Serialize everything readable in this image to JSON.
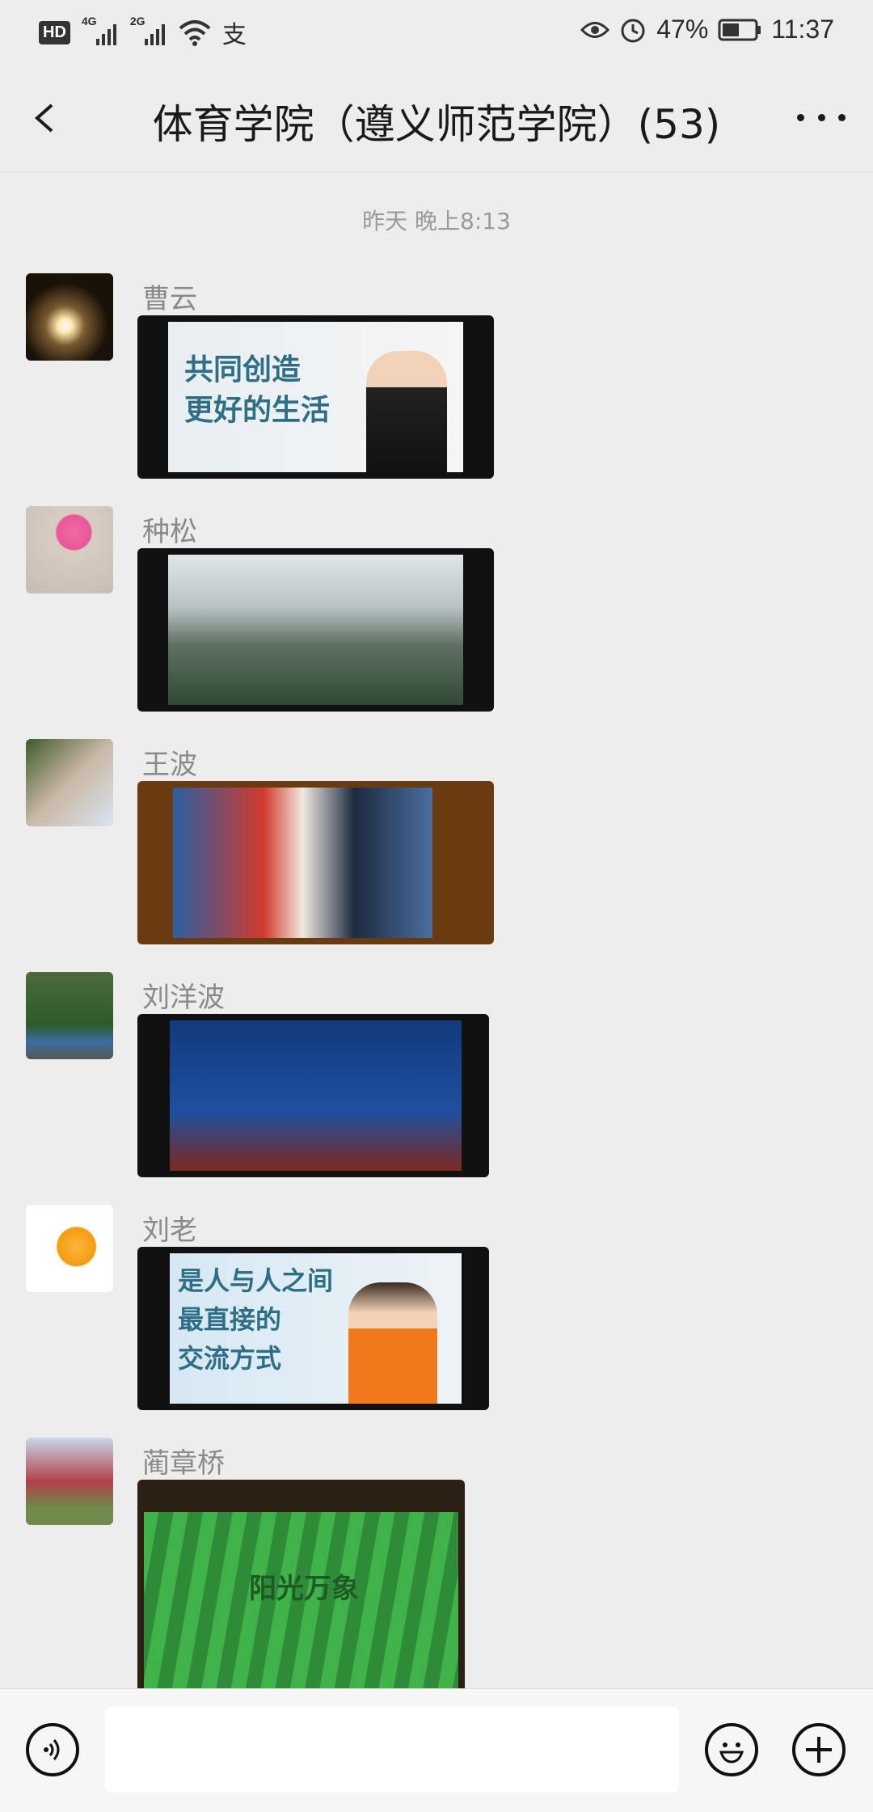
{
  "status": {
    "network": "4G",
    "network2": "2G",
    "alipay_glyph": "支",
    "battery": "47%",
    "time": "11:37"
  },
  "header": {
    "title": "体育学院（遵义师范学院）(53)"
  },
  "timestamp": "昨天 晚上8:13",
  "messages": [
    {
      "sender": "曹云",
      "video_caption": "共同创造\n更好的生活"
    },
    {
      "sender": "种松"
    },
    {
      "sender": "王波"
    },
    {
      "sender": "刘洋波"
    },
    {
      "sender": "刘老",
      "video_caption": "是人与人之间\n最直接的\n交流方式"
    },
    {
      "sender": "蔺章桥",
      "video_caption": "阳光万象"
    }
  ],
  "icons": [
    "back-arrow-icon",
    "more-icon",
    "voice-icon",
    "emoji-icon",
    "plus-icon",
    "eye-icon",
    "alarm-icon",
    "wifi-icon",
    "battery-icon",
    "signal-icon"
  ]
}
